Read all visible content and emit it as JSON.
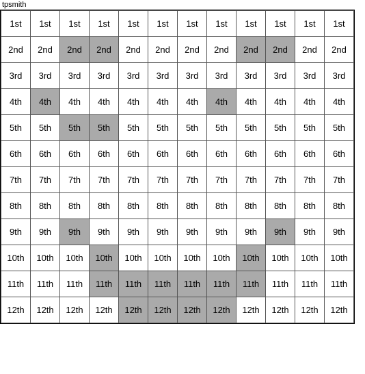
{
  "title": "tpsmith",
  "rows": [
    {
      "label": "1st",
      "highlights": [
        false,
        false,
        false,
        false,
        false,
        false,
        false,
        false,
        false,
        false,
        false,
        false
      ]
    },
    {
      "label": "2nd",
      "highlights": [
        false,
        false,
        true,
        true,
        false,
        false,
        false,
        false,
        true,
        true,
        false,
        false
      ]
    },
    {
      "label": "3rd",
      "highlights": [
        false,
        false,
        false,
        false,
        false,
        false,
        false,
        false,
        false,
        false,
        false,
        false
      ]
    },
    {
      "label": "4th",
      "highlights": [
        false,
        true,
        false,
        false,
        false,
        false,
        false,
        true,
        false,
        false,
        false,
        false
      ]
    },
    {
      "label": "5th",
      "highlights": [
        false,
        false,
        true,
        true,
        false,
        false,
        false,
        false,
        false,
        false,
        false,
        false
      ]
    },
    {
      "label": "6th",
      "highlights": [
        false,
        false,
        false,
        false,
        false,
        false,
        false,
        false,
        false,
        false,
        false,
        false
      ]
    },
    {
      "label": "7th",
      "highlights": [
        false,
        false,
        false,
        false,
        false,
        false,
        false,
        false,
        false,
        false,
        false,
        false
      ]
    },
    {
      "label": "8th",
      "highlights": [
        false,
        false,
        false,
        false,
        false,
        false,
        false,
        false,
        false,
        false,
        false,
        false
      ]
    },
    {
      "label": "9th",
      "highlights": [
        false,
        false,
        true,
        false,
        false,
        false,
        false,
        false,
        false,
        true,
        false,
        false
      ]
    },
    {
      "label": "10th",
      "highlights": [
        false,
        false,
        false,
        true,
        false,
        false,
        false,
        false,
        true,
        false,
        false,
        false
      ]
    },
    {
      "label": "11th",
      "highlights": [
        false,
        false,
        false,
        true,
        true,
        true,
        true,
        true,
        true,
        false,
        false,
        false
      ]
    },
    {
      "label": "12th",
      "highlights": [
        false,
        false,
        false,
        false,
        true,
        true,
        true,
        true,
        false,
        false,
        false,
        false
      ]
    }
  ],
  "cols": 12
}
